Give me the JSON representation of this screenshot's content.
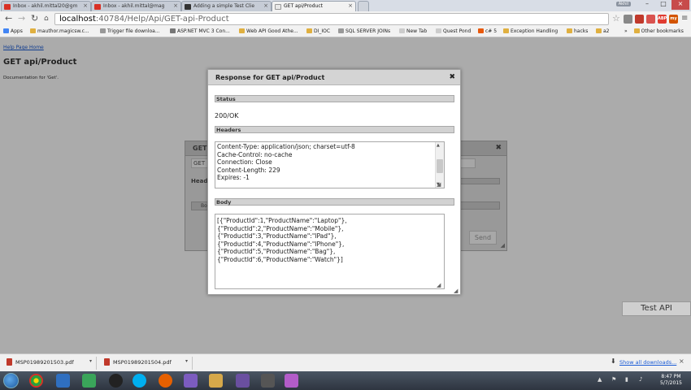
{
  "browser": {
    "tabs": [
      {
        "title": "Inbox - akhil.mittal20@gm",
        "color": "#d93025"
      },
      {
        "title": "Inbox - akhil.mittal@mag",
        "color": "#d93025"
      },
      {
        "title": "Adding a simple Test Clie",
        "color": "#333333"
      },
      {
        "title": "GET api/Product",
        "color": "#9aa0a6"
      }
    ],
    "user_badge": "Akhil",
    "address": {
      "host": "localhost",
      "rest": ":40784/Help/Api/GET-api-Product"
    },
    "extensions": [
      "",
      "",
      "",
      "",
      "",
      "ABP",
      "my"
    ]
  },
  "bookmarks": [
    {
      "label": "Apps",
      "color": "#4285f4"
    },
    {
      "label": "mauthor.magicsw.c...",
      "color": "#e0b040"
    },
    {
      "label": "Trigger file downloa...",
      "color": "#999999"
    },
    {
      "label": "ASP.NET MVC 3 Con...",
      "color": "#777777"
    },
    {
      "label": "Web API Good Athe...",
      "color": "#e0b040"
    },
    {
      "label": "DI_IOC",
      "color": "#e0b040"
    },
    {
      "label": "SQL SERVER JOINs",
      "color": "#999999"
    },
    {
      "label": "New Tab",
      "color": "#cccccc"
    },
    {
      "label": "Quest Pond",
      "color": "#cccccc"
    },
    {
      "label": "c# 5",
      "color": "#e8590c"
    },
    {
      "label": "Exception Handling",
      "color": "#e0b040"
    },
    {
      "label": "hacks",
      "color": "#e0b040"
    },
    {
      "label": "a2",
      "color": "#e0b040"
    },
    {
      "label": "Other bookmarks",
      "color": "#e0b040"
    }
  ],
  "page": {
    "help_link": "Help Page Home",
    "title": "GET api/Product",
    "doc": "Documentation for 'Get'.",
    "test_api_button": "Test API"
  },
  "test_client": {
    "title": "GET",
    "method": "GET",
    "headers_label": "Heade",
    "body_label": "Bo",
    "send_label": "Send"
  },
  "response": {
    "title": "Response for GET api/Product",
    "status_label": "Status",
    "status_value": "200/OK",
    "headers_label": "Headers",
    "headers_lines": [
      "Content-Type: application/json; charset=utf-8",
      "Cache-Control: no-cache",
      "Connection: Close",
      "Content-Length: 229",
      "Expires: -1"
    ],
    "body_label": "Body",
    "body_lines": [
      "[{\"ProductId\":1,\"ProductName\":\"Laptop\"},",
      "{\"ProductId\":2,\"ProductName\":\"Mobile\"},",
      "{\"ProductId\":3,\"ProductName\":\"IPad\"},",
      "{\"ProductId\":4,\"ProductName\":\"IPhone\"},",
      "{\"ProductId\":5,\"ProductName\":\"Bag\"},",
      "{\"ProductId\":6,\"ProductName\":\"Watch\"}]"
    ]
  },
  "downloads": {
    "items": [
      "MSP01989201503.pdf",
      "MSP01989201504.pdf"
    ],
    "show_all": "Show all downloads..."
  },
  "taskbar": {
    "time": "8:47 PM",
    "date": "5/7/2015"
  }
}
